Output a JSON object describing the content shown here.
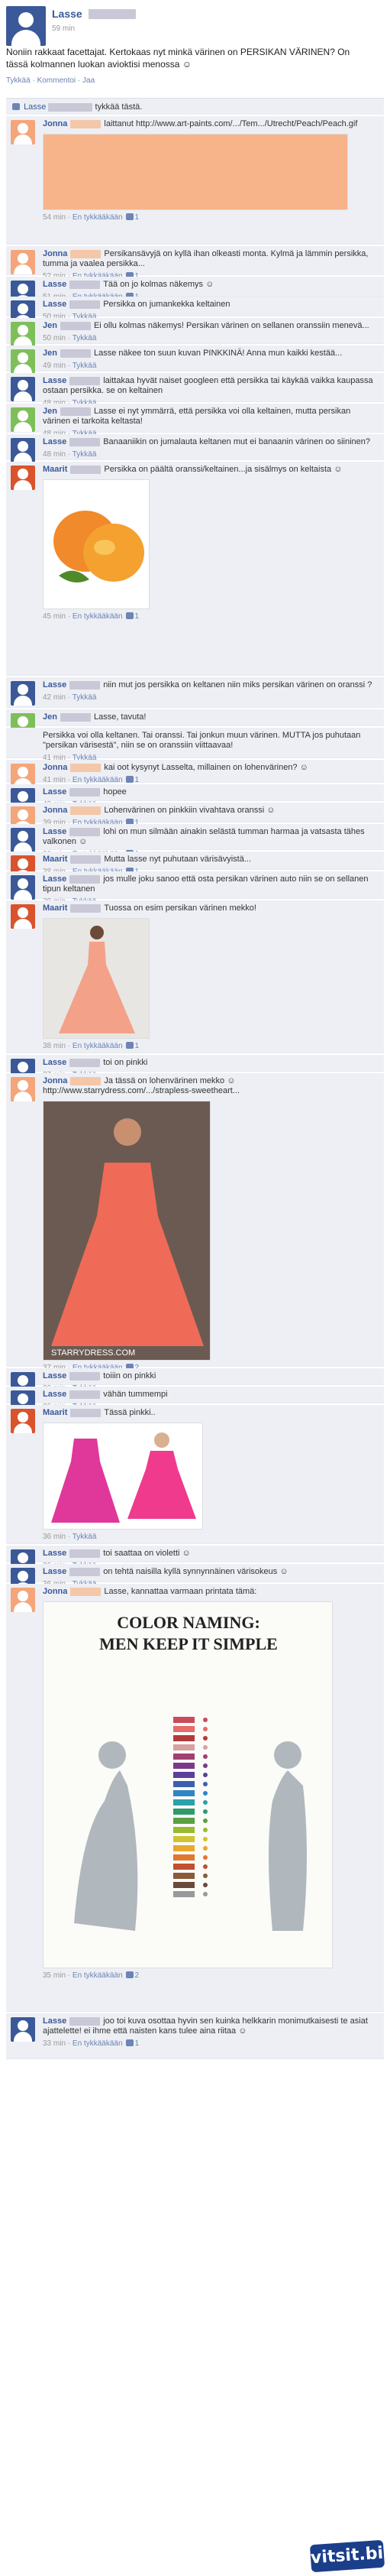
{
  "post": {
    "author": "Lasse",
    "time": "59 min",
    "text": "Noniin rakkaat facettajat. Kertokaas nyt minkä värinen on PERSIKAN VÄRINEN? On tässä kolmannen luokan avioktisi menossa ☺",
    "actions": "Tykkää · Kommentoi · Jaa",
    "likes_text": "tykkää tästä.",
    "likes_name": "Lasse"
  },
  "labels": {
    "like": "Tykkää",
    "unlike": "En tykkääkään"
  },
  "comments": [
    {
      "name": "Jonna",
      "text": "laittanut http://www.art-paints.com/.../Tem.../Utrecht/Peach/Peach.gif",
      "time": "54 min",
      "likes": "1",
      "img": "peach-swatch",
      "color": "#f4a57a"
    },
    {
      "name": "Jonna",
      "text": "Persikansävyjä on kyllä ihan olkeasti monta. Kylmä ja lämmin persikka, tumma ja vaalea persikka...",
      "time": "52 min",
      "likes": "1",
      "color": "#f4a57a"
    },
    {
      "name": "Lasse",
      "text": "Tää on jo kolmas näkemys ☺",
      "time": "51 min",
      "likes": "1",
      "color": "#3b5998"
    },
    {
      "name": "Lasse",
      "text": "Persikka on jumankekka keltainen",
      "time": "50 min",
      "likes": "",
      "color": "#3b5998"
    },
    {
      "name": "Jen",
      "text": "Ei ollu kolmas näkemys! Persikan värinen on sellanen oranssiin menevä...",
      "time": "50 min",
      "likes": "",
      "color": "#7fbf5a"
    },
    {
      "name": "Jen",
      "text": "Lasse näkee ton suun kuvan PINKKINÄ! Anna mun kaikki kestää...",
      "time": "49 min",
      "likes": "",
      "color": "#7fbf5a"
    },
    {
      "name": "Lasse",
      "text": "laittakaa hyvät naiset googleen että persikka tai käykää vaikka kaupassa ostaan persikka. se on keltainen",
      "time": "48 min",
      "likes": "",
      "color": "#3b5998"
    },
    {
      "name": "Jen",
      "text": "Lasse ei nyt ymmärrä, että persikka voi olla keltainen, mutta persikan värinen ei tarkoita keltasta!",
      "time": "48 min",
      "likes": "",
      "color": "#7fbf5a"
    },
    {
      "name": "Lasse",
      "text": "Banaaniikin on jumalauta keltanen mut ei banaanin värinen oo siininen?",
      "time": "48 min",
      "likes": "",
      "color": "#3b5998"
    },
    {
      "name": "Maarit",
      "text": "Persikka on päältä oranssi/keltainen...ja sisälmys on keltaista ☺",
      "time": "45 min",
      "likes": "1",
      "img": "peaches",
      "color": "#d9532c"
    },
    {
      "name": "Lasse",
      "text": "niin mut jos persikka on keltanen niin miks persikan värinen on oranssi ?",
      "time": "42 min",
      "likes": "",
      "color": "#3b5998"
    },
    {
      "name": "Jen",
      "text": "Lasse, tavuta!",
      "time": "",
      "likes": "",
      "color": "#7fbf5a"
    },
    {
      "name": "",
      "text": "Persikka voi olla keltanen. Tai oranssi. Tai jonkun muun värinen. MUTTA jos puhutaan \"persikan värisestä\", niin se on oranssiin viittaavaa!",
      "time": "41 min",
      "likes": "",
      "color": ""
    },
    {
      "name": "Jonna",
      "text": "kai oot kysynyt Lasselta, millainen on lohenvärinen? ☺",
      "time": "41 min",
      "likes": "1",
      "color": "#f4a57a"
    },
    {
      "name": "Lasse",
      "text": "hopee",
      "time": "40 min",
      "likes": "",
      "color": "#3b5998"
    },
    {
      "name": "Jonna",
      "text": "Lohenvärinen on pinkkiin vivahtava oranssi ☺",
      "time": "39 min",
      "likes": "1",
      "color": "#f4a57a"
    },
    {
      "name": "Lasse",
      "text": "lohi on mun silmään ainakin selästä tumman harmaa ja vatsasta tähes valkonen ☺",
      "time": "38 min",
      "likes": "1",
      "color": "#3b5998"
    },
    {
      "name": "Maarit",
      "text": "Mutta lasse nyt puhutaan värisävyistä...",
      "time": "38 min",
      "likes": "1",
      "color": "#d9532c"
    },
    {
      "name": "Lasse",
      "text": "jos mulle joku sanoo että osta persikan värinen auto niin se on sellanen tipun keltanen",
      "time": "38 min",
      "likes": "",
      "color": "#3b5998"
    },
    {
      "name": "Maarit",
      "text": "Tuossa on esim persikan värinen mekko!",
      "time": "38 min",
      "likes": "1",
      "img": "dress1",
      "color": "#d9532c"
    },
    {
      "name": "Lasse",
      "text": "toi on pinkki",
      "time": "37 min",
      "likes": "",
      "color": "#3b5998"
    },
    {
      "name": "Jonna",
      "text": "Ja tässä on lohenvärinen mekko ☺ http://www.starrydress.com/.../strapless-sweetheart...",
      "time": "37 min",
      "likes": "2",
      "img": "dress2",
      "color": "#f4a57a"
    },
    {
      "name": "Lasse",
      "text": "toiiin on pinkki",
      "time": "36 min",
      "likes": "",
      "color": "#3b5998"
    },
    {
      "name": "Lasse",
      "text": "vähän tummempi",
      "time": "36 min",
      "likes": "",
      "color": "#3b5998"
    },
    {
      "name": "Maarit",
      "text": "Tässä pinkki..",
      "time": "36 min",
      "likes": "",
      "img": "pink-dresses",
      "color": "#d9532c"
    },
    {
      "name": "Lasse",
      "text": "toi saattaa on violetti ☺",
      "time": "36 min",
      "likes": "",
      "color": "#3b5998"
    },
    {
      "name": "Lasse",
      "text": "on tehtä naisilla kyllä synnynnäinen värisokeus ☺",
      "time": "36 min",
      "likes": "",
      "color": "#3b5998"
    },
    {
      "name": "Jonna",
      "text": "Lasse, kannattaa varmaan printata tämä:",
      "time": "35 min",
      "likes": "2",
      "img": "color-naming",
      "color": "#f4a57a"
    },
    {
      "name": "Lasse",
      "text": "joo toi kuva osottaa hyvin sen kuinka helkkarin monimutkaisesti te asiat ajattelette! ei ihme että naisten kans tulee aina riitaa ☺",
      "time": "33 min",
      "likes": "1",
      "color": "#3b5998"
    }
  ],
  "images": {
    "color_naming_title1": "COLOR NAMING:",
    "color_naming_title2": "MEN KEEP IT SIMPLE",
    "starry": "STARRYDRESS.COM"
  },
  "watermark": "vitsit.biz"
}
